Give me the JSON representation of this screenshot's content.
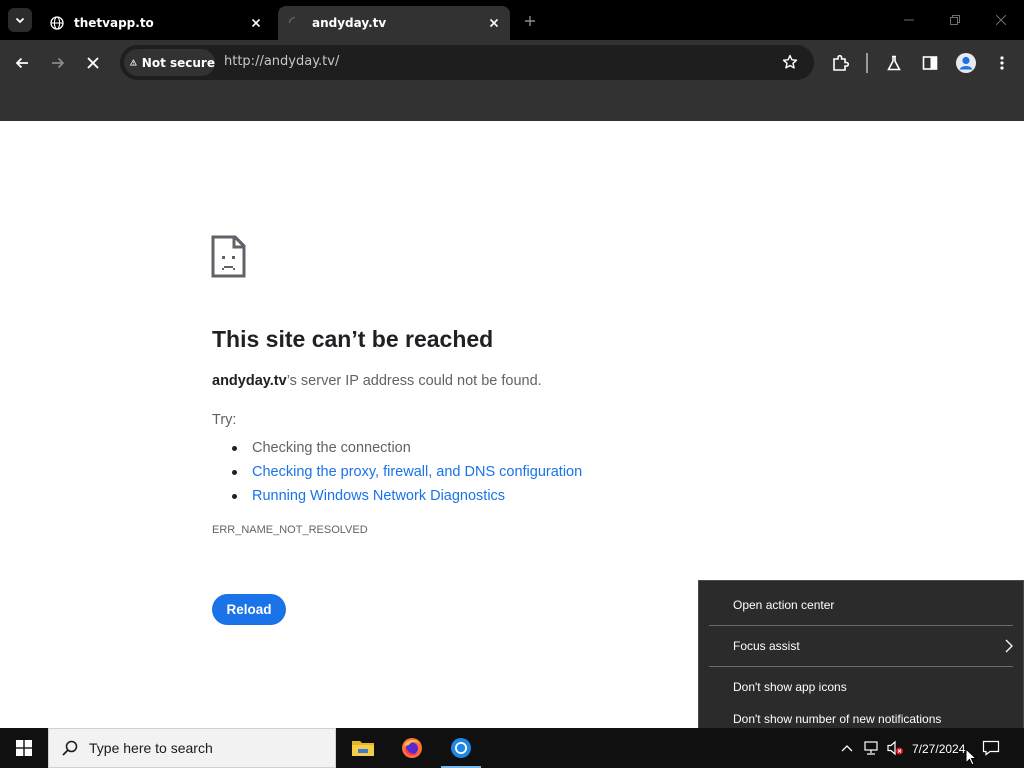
{
  "browser": {
    "tabs": [
      {
        "title": "thetvapp.to",
        "active": false,
        "favicon": "globe-icon"
      },
      {
        "title": "andyday.tv",
        "active": true,
        "favicon": "loading-spinner-icon"
      }
    ],
    "address_bar": {
      "security_label": "Not secure",
      "url": "http://andyday.tv/"
    },
    "toolbar_icons": [
      "back-icon",
      "forward-icon",
      "stop-icon",
      "bookmark-star-icon",
      "extensions-icon",
      "labs-flask-icon",
      "side-panel-icon",
      "profile-avatar-icon",
      "more-menu-icon"
    ]
  },
  "error_page": {
    "title": "This site can’t be reached",
    "host": "andyday.tv",
    "description_suffix": "’s server IP address could not be found.",
    "try_label": "Try:",
    "suggestions": [
      {
        "text": "Checking the connection",
        "link": false
      },
      {
        "text": "Checking the proxy, firewall, and DNS configuration",
        "link": true
      },
      {
        "text": "Running Windows Network Diagnostics",
        "link": true
      }
    ],
    "error_code": "ERR_NAME_NOT_RESOLVED",
    "reload_label": "Reload"
  },
  "context_menu": {
    "items": [
      {
        "label": "Open action center",
        "submenu": false
      },
      {
        "label": "Focus assist",
        "submenu": true
      },
      {
        "label": "Don't show app icons",
        "submenu": false
      },
      {
        "label": "Don't show number of new notifications",
        "submenu": false
      }
    ]
  },
  "taskbar": {
    "search_placeholder": "Type here to search",
    "apps": [
      "file-explorer-icon",
      "firefox-icon",
      "chrome-icon"
    ],
    "clock": "7/27/2024"
  },
  "colors": {
    "link": "#1a73e8",
    "reload_button": "#1a73e8",
    "toolbar_bg": "#323232",
    "tabstrip_bg": "#000000"
  }
}
